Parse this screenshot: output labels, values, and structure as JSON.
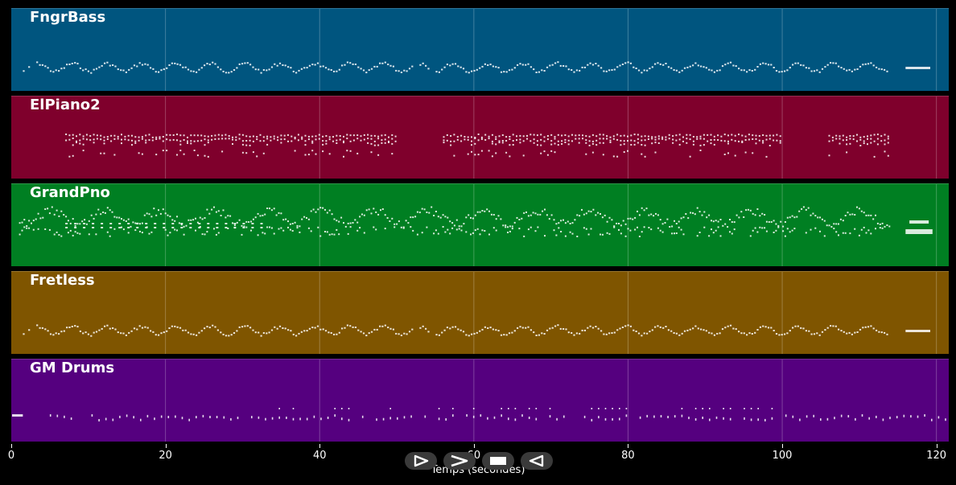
{
  "tracks": [
    {
      "name": "FngrBass",
      "color": "#00557f"
    },
    {
      "name": "ElPiano2",
      "color": "#7f002c"
    },
    {
      "name": "GrandPno",
      "color": "#007f22"
    },
    {
      "name": "Fretless",
      "color": "#7f5500"
    },
    {
      "name": "GM Drums",
      "color": "#55007f"
    }
  ],
  "axis": {
    "title": "Temps (secondes)",
    "min": 0,
    "max": 121.6,
    "ticks": [
      "0",
      "20",
      "40",
      "60",
      "80",
      "100",
      "120"
    ]
  },
  "controls": {
    "buttons": [
      "play-icon",
      "forward-icon",
      "stop-icon",
      "rewind-icon"
    ]
  }
}
